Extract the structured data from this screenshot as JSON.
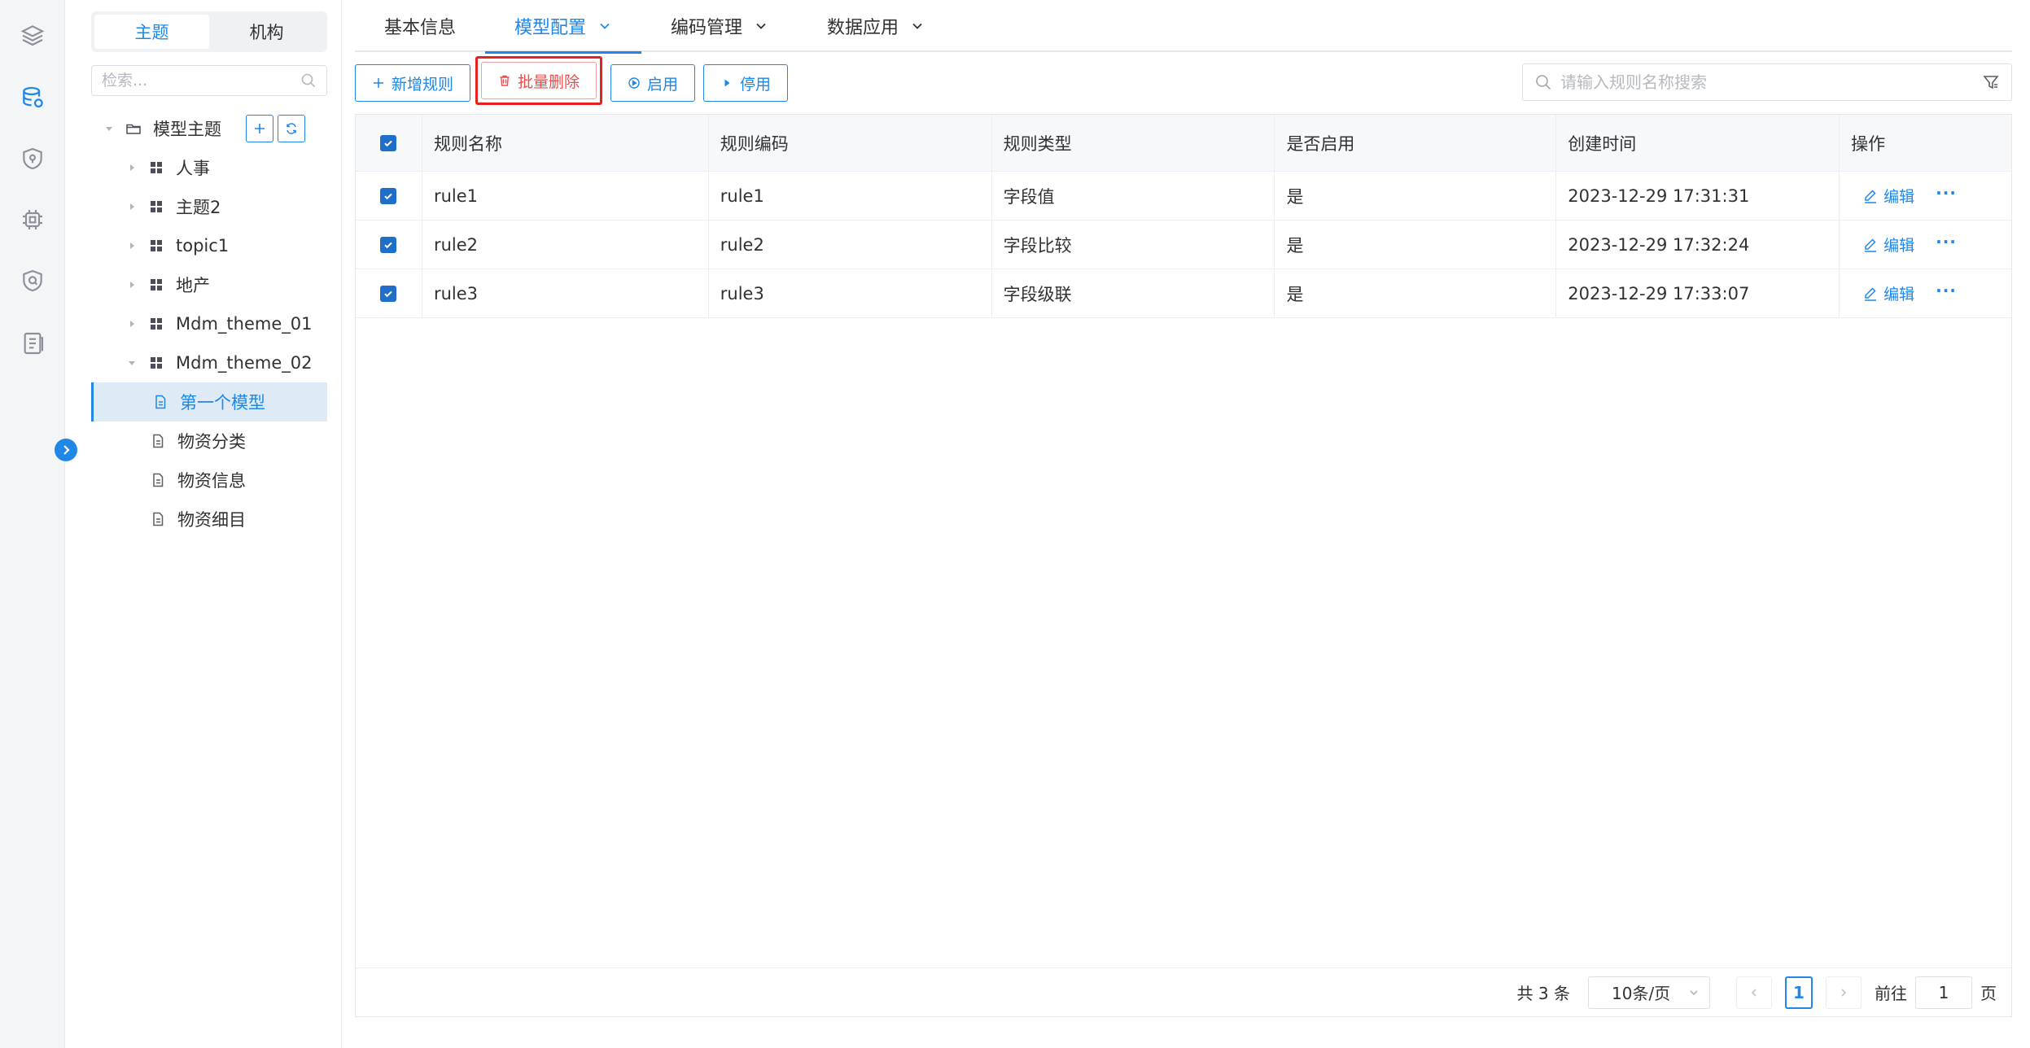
{
  "rail": {
    "icons": [
      "layers-icon",
      "database-icon",
      "shield-icon",
      "chip-icon",
      "shield-check-icon",
      "document-list-icon"
    ],
    "active_index": 1
  },
  "sidebar": {
    "segments": [
      "主题",
      "机构"
    ],
    "active_segment": 0,
    "search_placeholder": "检索...",
    "root_label": "模型主题",
    "themes": [
      "人事",
      "主题2",
      "topic1",
      "地产",
      "Mdm_theme_01",
      "Mdm_theme_02"
    ],
    "models": [
      "第一个模型",
      "物资分类",
      "物资信息",
      "物资细目"
    ],
    "selected_model": "第一个模型"
  },
  "tabs": [
    {
      "label": "基本信息",
      "dropdown": false
    },
    {
      "label": "模型配置",
      "dropdown": true,
      "active": true
    },
    {
      "label": "编码管理",
      "dropdown": true
    },
    {
      "label": "数据应用",
      "dropdown": true
    }
  ],
  "toolbar": {
    "add_label": "新增规则",
    "batch_delete_label": "批量删除",
    "enable_label": "启用",
    "disable_label": "停用"
  },
  "search": {
    "placeholder": "请输入规则名称搜索"
  },
  "table": {
    "headers": [
      "规则名称",
      "规则编码",
      "规则类型",
      "是否启用",
      "创建时间",
      "操作"
    ],
    "rows": [
      {
        "name": "rule1",
        "code": "rule1",
        "type": "字段值",
        "enabled": "是",
        "created": "2023-12-29 17:31:31"
      },
      {
        "name": "rule2",
        "code": "rule2",
        "type": "字段比较",
        "enabled": "是",
        "created": "2023-12-29 17:32:24"
      },
      {
        "name": "rule3",
        "code": "rule3",
        "type": "字段级联",
        "enabled": "是",
        "created": "2023-12-29 17:33:07"
      }
    ],
    "edit_label": "编辑",
    "more_label": "···"
  },
  "pager": {
    "total": "共 3 条",
    "page_size": "10条/页",
    "current_page": "1",
    "goto_prefix": "前往",
    "goto_value": "1",
    "goto_suffix": "页"
  },
  "colors": {
    "accent": "#1f87e8",
    "danger": "#f04a4a",
    "highlight_frame": "#e8201e"
  }
}
